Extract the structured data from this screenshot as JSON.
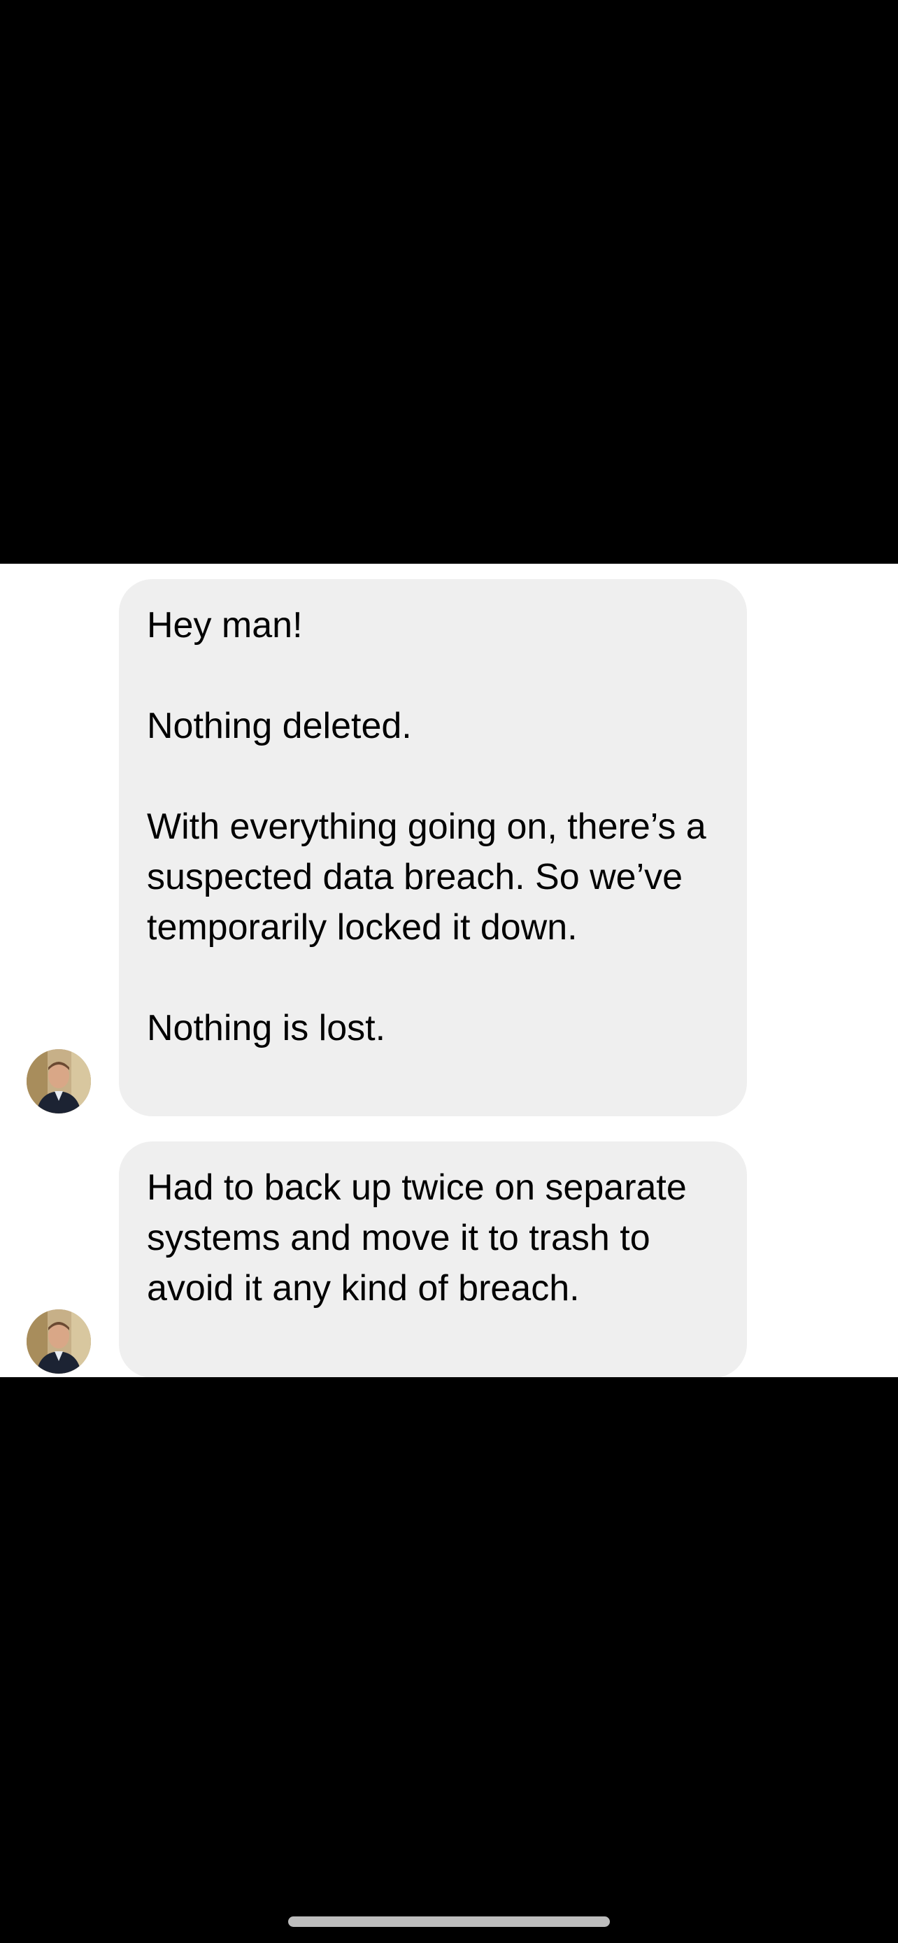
{
  "messages": [
    {
      "paragraphs": [
        "Hey man!",
        "Nothing deleted.",
        "With everything going on, there’s a suspected data breach. So we’ve temporarily locked it down.",
        "Nothing is lost."
      ]
    },
    {
      "paragraphs": [
        "Had to back up twice on separate systems and move it to trash to avoid it any kind of breach."
      ]
    }
  ],
  "colors": {
    "bubble_background": "#efefef",
    "chat_background": "#ffffff",
    "letterbox": "#000000",
    "home_indicator": "#bdbdbd"
  },
  "icons": {
    "avatar": "sender-avatar-photo",
    "home_indicator": "home-indicator-bar"
  }
}
